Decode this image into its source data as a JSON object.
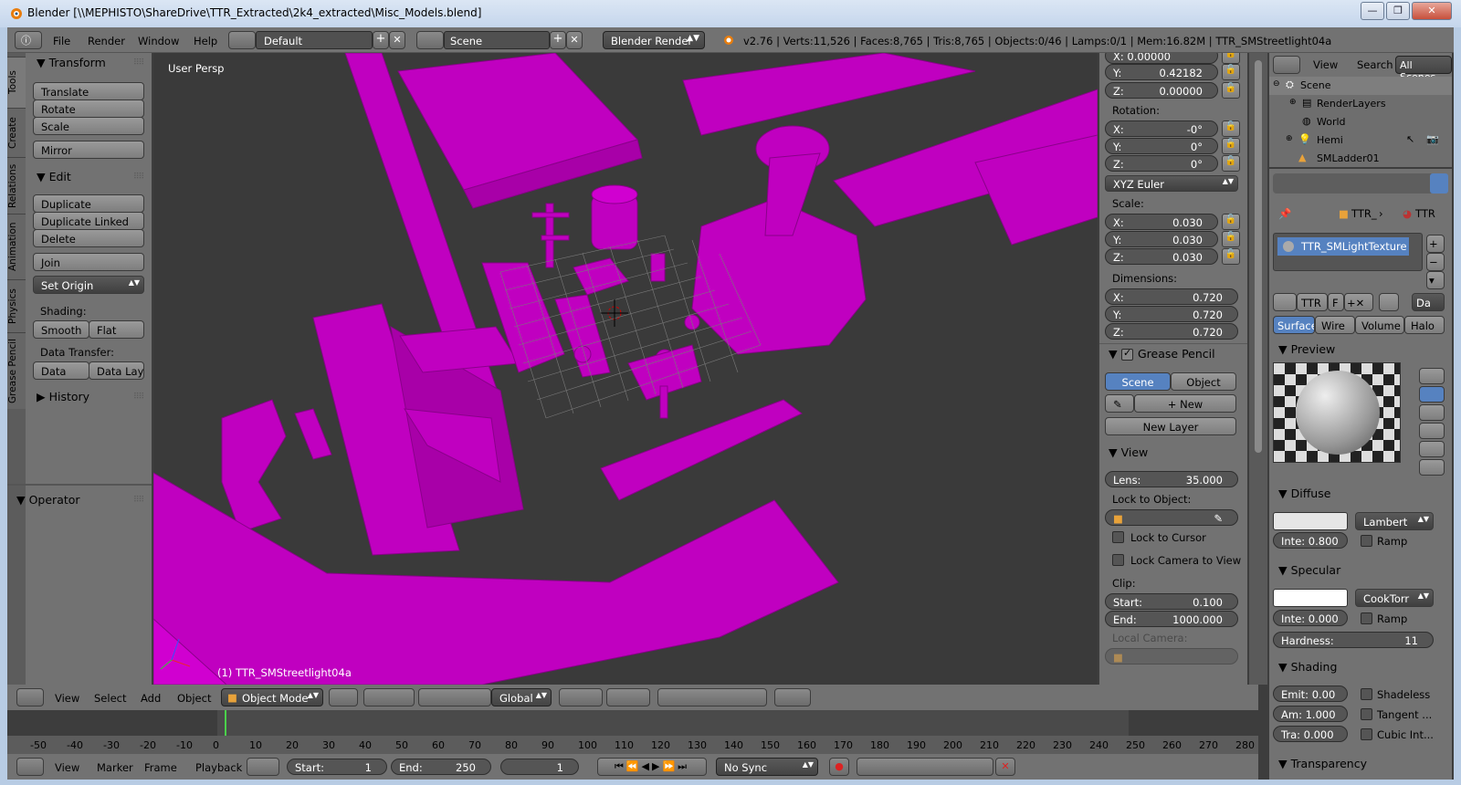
{
  "title_bar": {
    "text": "Blender [\\\\MEPHISTO\\ShareDrive\\TTR_Extracted\\2k4_extracted\\Misc_Models.blend]",
    "buttons": [
      "—",
      "❐",
      "✕"
    ]
  },
  "info_header": {
    "menus": [
      "File",
      "Render",
      "Window",
      "Help"
    ],
    "screen_layout": "Default",
    "scene": "Scene",
    "render_engine": "Blender Render",
    "stats": "v2.76 | Verts:11,526 | Faces:8,765 | Tris:8,765 | Objects:0/46 | Lamps:0/1 | Mem:16.82M | TTR_SMStreetlight04a"
  },
  "tool_tabs": [
    "Tools",
    "Create",
    "Relations",
    "Animation",
    "Physics",
    "Grease Pencil"
  ],
  "toolshelf": {
    "transform": {
      "header": "Transform",
      "buttons": [
        "Translate",
        "Rotate",
        "Scale"
      ],
      "mirror": "Mirror"
    },
    "edit": {
      "header": "Edit",
      "buttons": [
        "Duplicate",
        "Duplicate Linked",
        "Delete"
      ],
      "join": "Join",
      "set_origin": "Set Origin"
    },
    "shading": {
      "label": "Shading:",
      "smooth": "Smooth",
      "flat": "Flat"
    },
    "data_transfer": {
      "label": "Data Transfer:",
      "data": "Data",
      "data_layout": "Data Layo"
    },
    "history": "History",
    "operator": "Operator"
  },
  "viewport": {
    "view_label": "User Persp",
    "object_label": "(1) TTR_SMStreetlight04a",
    "model_color": "#cc00cc",
    "background": "#3a3a3a"
  },
  "npanel": {
    "loc_x": "X:         0.00000",
    "loc_y_label": "Y:",
    "loc_y": "0.42182",
    "loc_z_label": "Z:",
    "loc_z": "0.00000",
    "rotation_label": "Rotation:",
    "rot": [
      {
        "axis": "X:",
        "value": "-0°"
      },
      {
        "axis": "Y:",
        "value": "0°"
      },
      {
        "axis": "Z:",
        "value": "0°"
      }
    ],
    "rot_mode": "XYZ Euler",
    "scale_label": "Scale:",
    "scale": [
      {
        "axis": "X:",
        "value": "0.030"
      },
      {
        "axis": "Y:",
        "value": "0.030"
      },
      {
        "axis": "Z:",
        "value": "0.030"
      }
    ],
    "dimensions_label": "Dimensions:",
    "dims": [
      {
        "axis": "X:",
        "value": "0.720"
      },
      {
        "axis": "Y:",
        "value": "0.720"
      },
      {
        "axis": "Z:",
        "value": "0.720"
      }
    ],
    "grease_pencil": {
      "header": "Grease Pencil",
      "scene": "Scene",
      "object": "Object",
      "new": "New",
      "new_layer": "New Layer"
    },
    "view": {
      "header": "View",
      "lens_label": "Lens:",
      "lens": "35.000",
      "lock_to_object": "Lock to Object:",
      "lock_cursor": "Lock to Cursor",
      "lock_camera": "Lock Camera to View",
      "clip_label": "Clip:",
      "clip_start_label": "Start:",
      "clip_start": "0.100",
      "clip_end_label": "End:",
      "clip_end": "1000.000",
      "local_camera": "Local Camera:"
    }
  },
  "outliner": {
    "menus": [
      "View",
      "Search"
    ],
    "filter": "All Scenes",
    "items": [
      {
        "label": "Scene",
        "icon": "scene-icon"
      },
      {
        "label": "RenderLayers",
        "icon": "renderlayers-icon"
      },
      {
        "label": "World",
        "icon": "world-icon"
      },
      {
        "label": "Hemi",
        "icon": "lamp-icon"
      },
      {
        "label": "SMLadder01",
        "icon": "object-icon"
      }
    ]
  },
  "properties": {
    "breadcrumb": [
      "TTR_",
      "TTR"
    ],
    "material": "TTR_SMLightTexture",
    "datablock": {
      "name": "TTR",
      "fake": "F",
      "data": "Da"
    },
    "tabs": [
      "Surface",
      "Wire",
      "Volume",
      "Halo"
    ],
    "preview_header": "Preview",
    "diffuse": {
      "header": "Diffuse",
      "shader": "Lambert",
      "intensity": "Inte: 0.800",
      "ramp": "Ramp",
      "color": "#e6e6e6"
    },
    "specular": {
      "header": "Specular",
      "shader": "CookTorr",
      "intensity": "Inte: 0.000",
      "ramp": "Ramp",
      "hardness_label": "Hardness:",
      "hardness": "11",
      "color": "#ffffff"
    },
    "shading": {
      "header": "Shading",
      "emit": "Emit: 0.00",
      "ambient": "Am: 1.000",
      "translucency": "Tra:  0.000",
      "shadeless": "Shadeless",
      "tangent": "Tangent ...",
      "cubic": "Cubic Int..."
    },
    "transparency_header": "Transparency"
  },
  "view3d_header": {
    "menus": [
      "View",
      "Select",
      "Add",
      "Object"
    ],
    "mode": "Object Mode",
    "orientation": "Global"
  },
  "timeline": {
    "ticks": [
      "-50",
      "-40",
      "-30",
      "-20",
      "-10",
      "0",
      "10",
      "20",
      "30",
      "40",
      "50",
      "60",
      "70",
      "80",
      "90",
      "100",
      "110",
      "120",
      "130",
      "140",
      "150",
      "160",
      "170",
      "180",
      "190",
      "200",
      "210",
      "220",
      "230",
      "240",
      "250",
      "260",
      "270",
      "280"
    ],
    "menus": [
      "View",
      "Marker",
      "Frame",
      "Playback"
    ],
    "start_label": "Start:",
    "start": "1",
    "end_label": "End:",
    "end": "250",
    "current": "1",
    "sync": "No Sync"
  }
}
